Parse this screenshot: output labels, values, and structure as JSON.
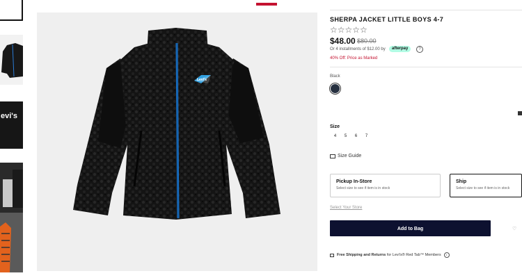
{
  "product": {
    "title": "SHERPA JACKET LITTLE BOYS 4-7",
    "stars": "☆☆☆☆☆",
    "price": "$48.00",
    "old_price": "$80.00",
    "installments": "Or 4 installments of $12.00 by",
    "afterpay_label": "afterpay",
    "info_glyph": "?",
    "discount": "40% Off: Price as Marked",
    "color_name": "Black",
    "swatch_color": "#263040"
  },
  "sizes": {
    "label": "Size",
    "options": [
      "4",
      "5",
      "6",
      "7"
    ],
    "guide_label": "Size Guide"
  },
  "fulfillment": {
    "pickup_title": "Pickup In-Store",
    "pickup_sub": "Select size to see if item is in stock",
    "ship_title": "Ship",
    "ship_sub": "Select size to see if item is in stock",
    "select_store": "Select Your Store"
  },
  "cta": {
    "add_to_bag": "Add to Bag",
    "wishlist_glyph": "♡"
  },
  "shipping_banner": {
    "bold": "Free Shipping and Returns",
    "rest": " for Levi's® Red Tab™ Members",
    "info_glyph": "i"
  },
  "jacket_logo_text": "Levi's",
  "thumb_logo_text": "evi's"
}
